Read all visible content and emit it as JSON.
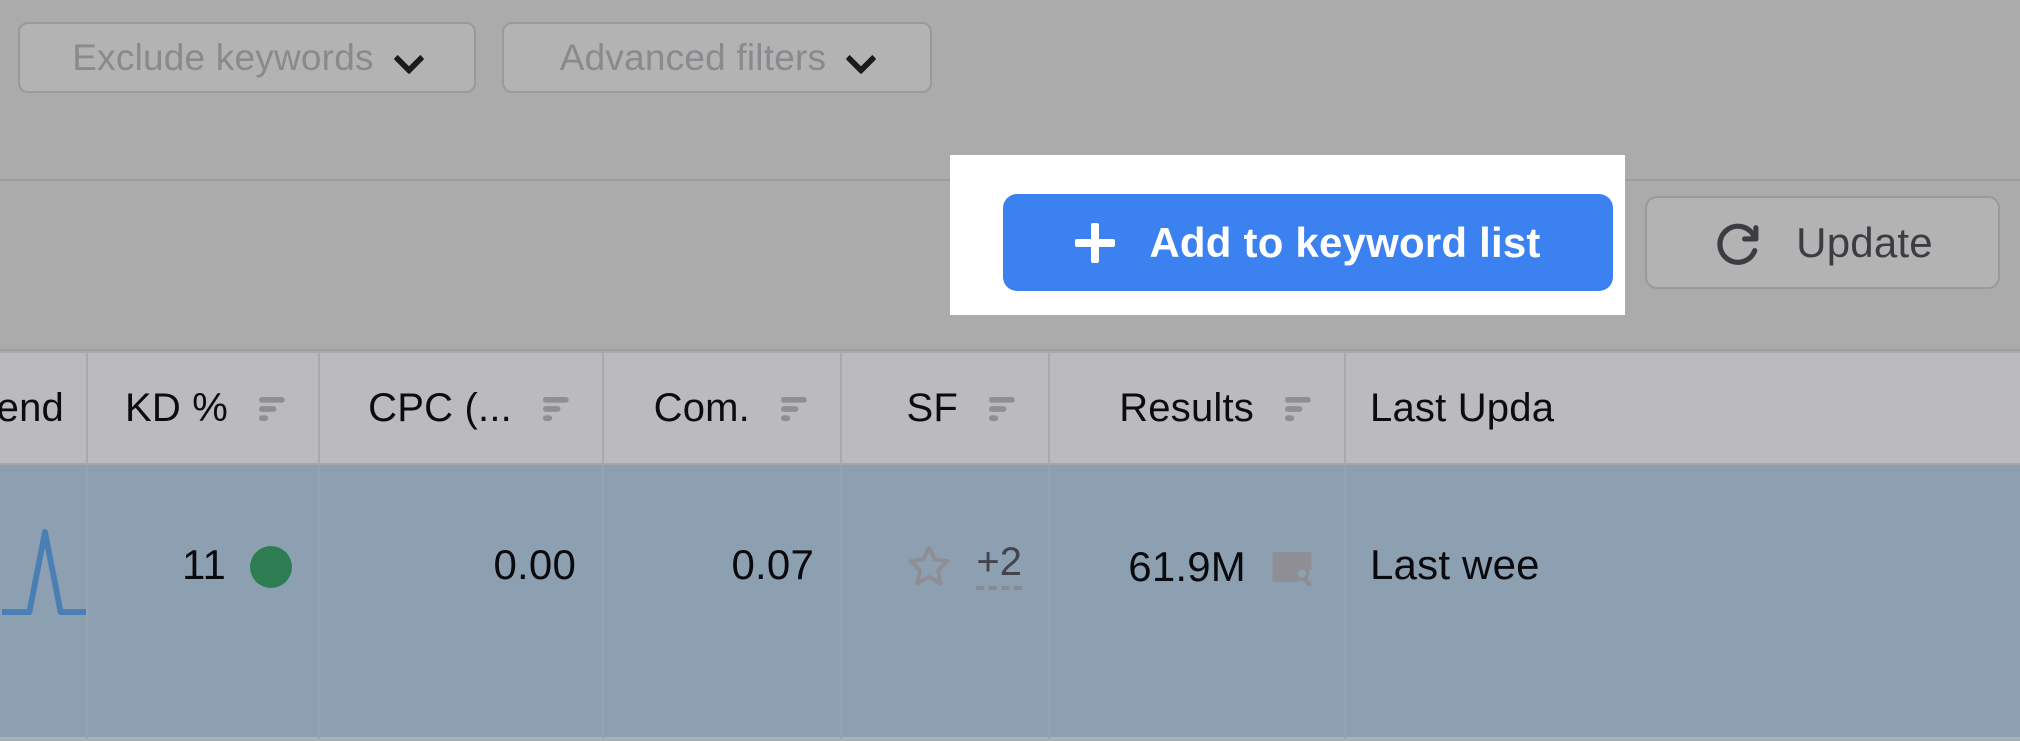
{
  "filter_bar": {
    "chips": [
      {
        "label": "Exclude keywords",
        "icon": "chevron-down-icon"
      },
      {
        "label": "Advanced filters",
        "icon": "chevron-down-icon"
      }
    ]
  },
  "toolbar": {
    "add_to_keyword_list_label": "Add to keyword list",
    "add_icon": "plus-icon",
    "update_label": "Update",
    "update_icon": "refresh-icon",
    "accent_color": "#3b82f0",
    "highlight_color": "#ffffff"
  },
  "table": {
    "columns": [
      {
        "key": "trend",
        "label": "end",
        "sortable": false
      },
      {
        "key": "kd",
        "label": "KD %",
        "sortable": true
      },
      {
        "key": "cpc",
        "label": "CPC (...",
        "sortable": true
      },
      {
        "key": "com",
        "label": "Com.",
        "sortable": true
      },
      {
        "key": "sf",
        "label": "SF",
        "sortable": true
      },
      {
        "key": "results",
        "label": "Results",
        "sortable": true
      },
      {
        "key": "last",
        "label": "Last Upda",
        "sortable": false
      }
    ],
    "rows": [
      {
        "selected": true,
        "trend": "",
        "kd": "11",
        "kd_dot_color": "#2e7d52",
        "cpc": "0.00",
        "com": "0.07",
        "sf_star": "star-icon",
        "sf_extra": "+2",
        "results": "61.9M",
        "results_icon": "serp-preview-icon",
        "last": "Last wee"
      }
    ],
    "header_bg": "#bbbbbd",
    "selected_row_bg": "#8da0b1"
  }
}
